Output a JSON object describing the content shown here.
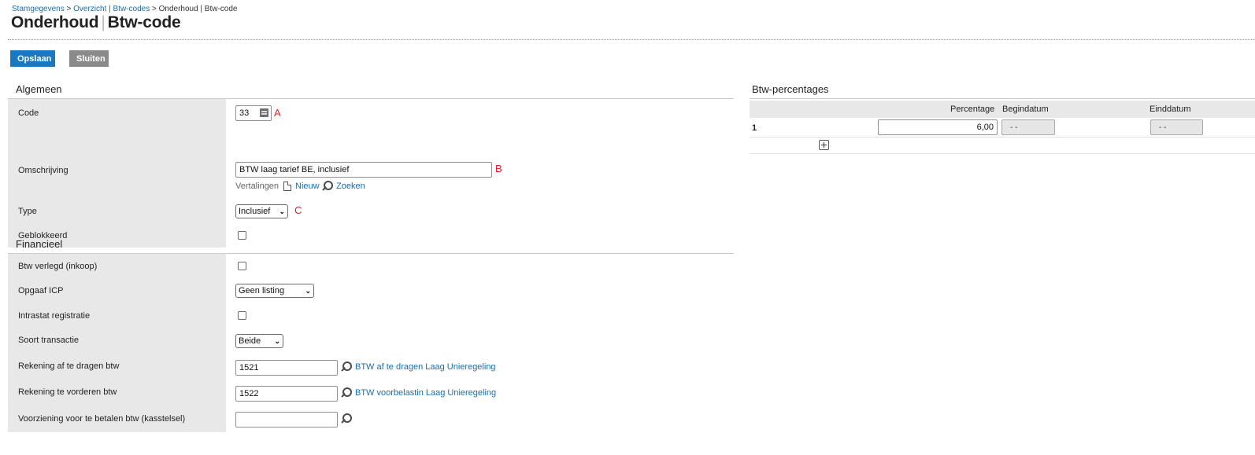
{
  "breadcrumb": {
    "item1": "Stamgegevens",
    "sep": ">",
    "item2": "Overzicht | Btw-codes",
    "current": "Onderhoud | Btw-code"
  },
  "title": {
    "part1": "Onderhoud",
    "part2": "Btw-code"
  },
  "toolbar": {
    "save_label": "Opslaan",
    "close_label": "Sluiten"
  },
  "algemeen": {
    "title": "Algemeen",
    "code": {
      "label": "Code",
      "value": "33",
      "marker": "A"
    },
    "omschrijving": {
      "label": "Omschrijving",
      "value": "BTW laag tarief BE, inclusief",
      "marker": "B"
    },
    "vertalingen": {
      "label": "Vertalingen",
      "nieuw": "Nieuw",
      "zoeken": "Zoeken"
    },
    "type": {
      "label": "Type",
      "value": "Inclusief",
      "marker": "C"
    },
    "geblokkeerd": {
      "label": "Geblokkeerd",
      "checked": false
    }
  },
  "financieel": {
    "title": "Financieel",
    "btw_verlegd": {
      "label": "Btw verlegd (inkoop)",
      "checked": false
    },
    "opgaaf_icp": {
      "label": "Opgaaf ICP",
      "value": "Geen listing"
    },
    "intrastat": {
      "label": "Intrastat registratie",
      "checked": false
    },
    "soort_transactie": {
      "label": "Soort transactie",
      "value": "Beide"
    },
    "rek_af_te_dragen": {
      "label": "Rekening af te dragen btw",
      "value": "1521",
      "desc": "BTW af te dragen Laag Unieregeling"
    },
    "rek_te_vorderen": {
      "label": "Rekening te vorderen btw",
      "value": "1522",
      "desc": "BTW voorbelastin Laag Unieregeling"
    },
    "voorziening": {
      "label": "Voorziening voor te betalen btw (kasstelsel)",
      "value": ""
    }
  },
  "percentages": {
    "title": "Btw-percentages",
    "headers": {
      "percentage": "Percentage",
      "begindatum": "Begindatum",
      "einddatum": "Einddatum"
    },
    "rows": [
      {
        "index": "1",
        "percentage": "6,00",
        "begindatum": "- -",
        "einddatum": "- -"
      }
    ]
  }
}
